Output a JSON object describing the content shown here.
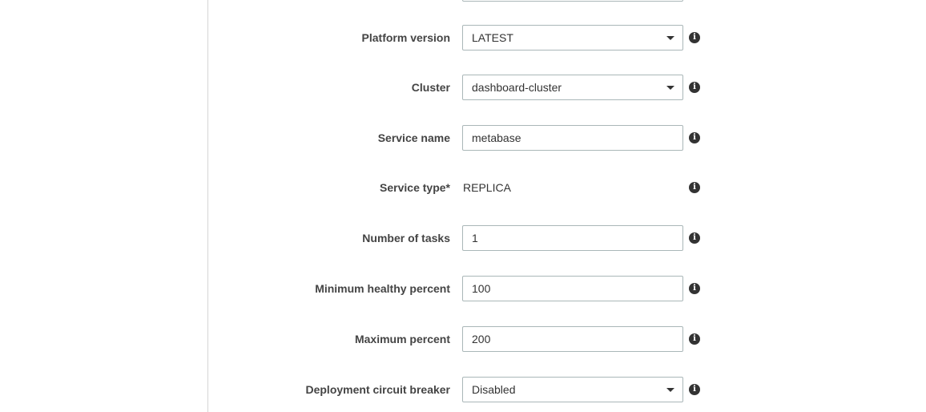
{
  "form": {
    "platform_version": {
      "label": "Platform version",
      "value": "LATEST"
    },
    "cluster": {
      "label": "Cluster",
      "value": "dashboard-cluster"
    },
    "service_name": {
      "label": "Service name",
      "value": "metabase"
    },
    "service_type": {
      "label": "Service type*",
      "value": "REPLICA"
    },
    "number_of_tasks": {
      "label": "Number of tasks",
      "value": "1"
    },
    "minimum_healthy_percent": {
      "label": "Minimum healthy percent",
      "value": "100"
    },
    "maximum_percent": {
      "label": "Maximum percent",
      "value": "200"
    },
    "deployment_circuit_breaker": {
      "label": "Deployment circuit breaker",
      "value": "Disabled"
    }
  },
  "icons": {
    "info": "info-icon",
    "dropdown": "caret-down-icon"
  },
  "colors": {
    "border": "#aab7b8",
    "label": "#444444",
    "text": "#333333"
  }
}
